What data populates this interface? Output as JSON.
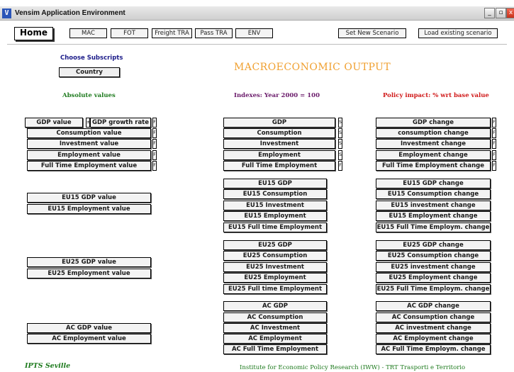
{
  "window": {
    "title": "Vensim Application Environment",
    "icon": "vensim-icon",
    "controls": [
      "_",
      "▫",
      "x"
    ]
  },
  "toolbar": {
    "home": "Home",
    "tabs": [
      "MAC",
      "FOT",
      "Freight TRA",
      "Pass TRA",
      "ENV"
    ],
    "set_new_scenario": "Set New Scenario",
    "load_existing_scenario": "Load existing scenario"
  },
  "subscripts": {
    "label": "Choose Subscripts",
    "country": "Country"
  },
  "main": {
    "title": "MACROECONOMIC OUTPUT",
    "col_absolute": "Absolute values",
    "col_indexes": "Indexes: Year 2000 = 100",
    "col_policy": "Policy impact: % wrt base value"
  },
  "colors": {
    "green": "#1d7a1d",
    "purple": "#6a1a6a",
    "red": "#d01818",
    "orange": "#f0a030",
    "navy": "#1d1d8a"
  },
  "absolute": {
    "gdp_value": "GDP value",
    "gdp_growth_rate": "GDP growth rate",
    "country": [
      "Consumption value",
      "Investment value",
      "Employment value",
      "Full Time Employment value"
    ],
    "eu15": [
      "EU15 GDP value",
      "EU15 Employment value"
    ],
    "eu25": [
      "EU25 GDP value",
      "EU25 Employment value"
    ],
    "ac": [
      "AC GDP value",
      "AC Employment value"
    ]
  },
  "indexes": {
    "country": [
      "GDP",
      "Consumption",
      "Investment",
      "Employment",
      "Full Time Employment"
    ],
    "eu15": [
      "EU15 GDP",
      "EU15 Consumption",
      "EU15 Investment",
      "EU15 Employment",
      "EU15 Full time Employment"
    ],
    "eu25": [
      "EU25 GDP",
      "EU25 Consumption",
      "EU25 Investment",
      "EU25 Employment",
      "EU25 Full time Employment"
    ],
    "ac": [
      "AC GDP",
      "AC Consumption",
      "AC Investment",
      "AC Employment",
      "AC Full Time Employment"
    ]
  },
  "policy": {
    "country": [
      "GDP change",
      "consumption change",
      "Investment change",
      "Employment change",
      "Full Time Employment change"
    ],
    "eu15": [
      "EU15 GDP change",
      "EU15 Consumption change",
      "EU15 investment change",
      "EU15 Employment change",
      "EU15 Full Time Employm. change"
    ],
    "eu25": [
      "EU25 GDP change",
      "EU25 Consumption change",
      "EU25 investment change",
      "EU25 Employment change",
      "EU25 Full Time Employm. change"
    ],
    "ac": [
      "AC GDP change",
      "AC Consumption change",
      "AC investment change",
      "AC Employment change",
      "AC Full Time Employm. change"
    ]
  },
  "selectors": {
    "gdp_value_sel": "±",
    "small": "F",
    "index": "S"
  },
  "footer": {
    "left": "IPTS Seville",
    "right": "Institute for Economic Policy Research (IWW) - TRT Trasporti e Territorio"
  }
}
